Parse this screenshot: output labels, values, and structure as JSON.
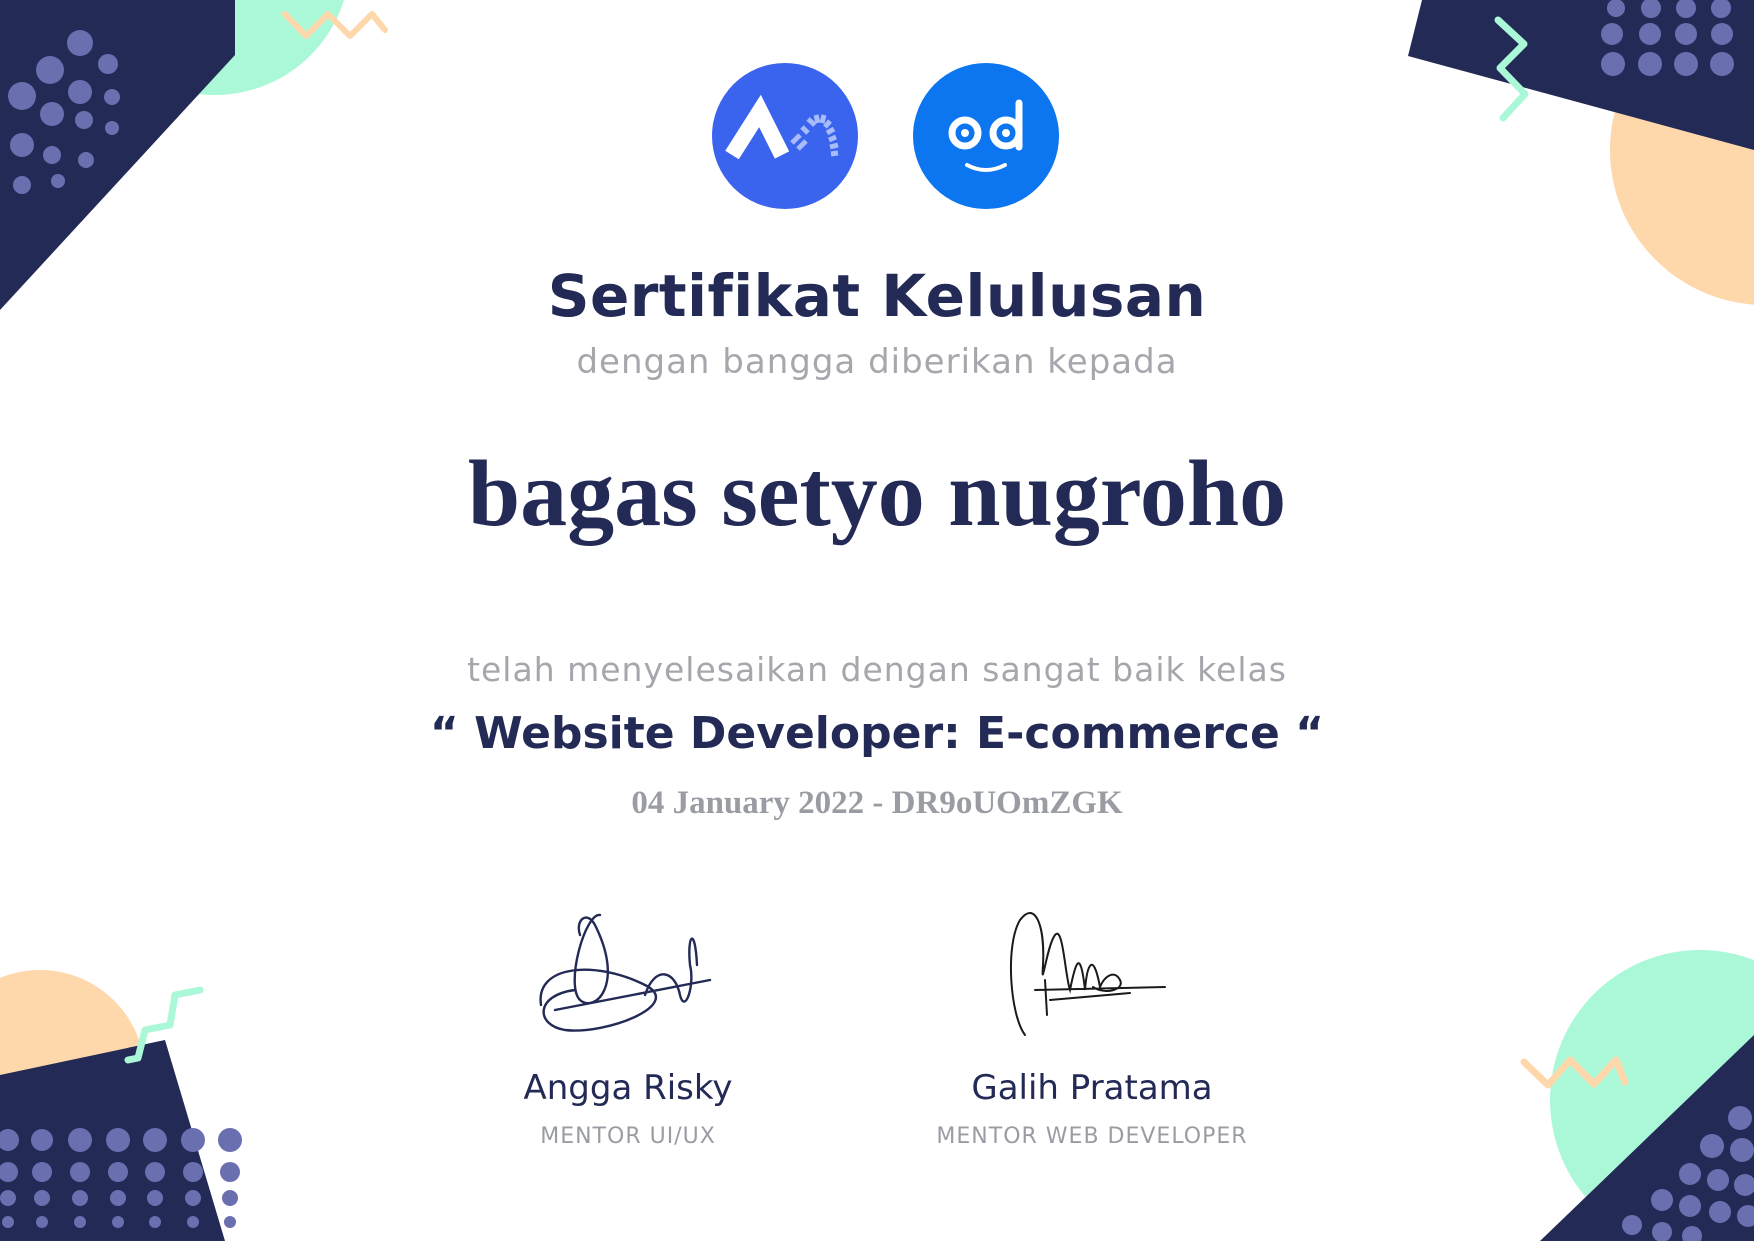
{
  "certificate": {
    "title": "Sertifikat Kelulusan",
    "subtitle": "dengan bangga diberikan kepada",
    "recipient": "bagas setyo nugroho",
    "completion_text": "telah menyelesaikan dengan sangat baik kelas",
    "course": "“ Website Developer: E-commerce “",
    "date": "04 January 2022",
    "separator": " - ",
    "certificate_id": "DR9oUOmZGK"
  },
  "logos": [
    {
      "icon": "buildwith-angga-logo-icon",
      "color": "#3a63ee"
    },
    {
      "icon": "odeo-smile-logo-icon",
      "color": "#0b76f0"
    }
  ],
  "signers": [
    {
      "name": "Angga Risky",
      "role": "MENTOR UI/UX"
    },
    {
      "name": "Galih Pratama",
      "role": "MENTOR WEB DEVELOPER"
    }
  ],
  "colors": {
    "navy": "#232a56",
    "mint": "#abf8d9",
    "peach": "#fed7ab",
    "dot": "#6a6fb0",
    "muted_text": "#a6a7ad"
  }
}
